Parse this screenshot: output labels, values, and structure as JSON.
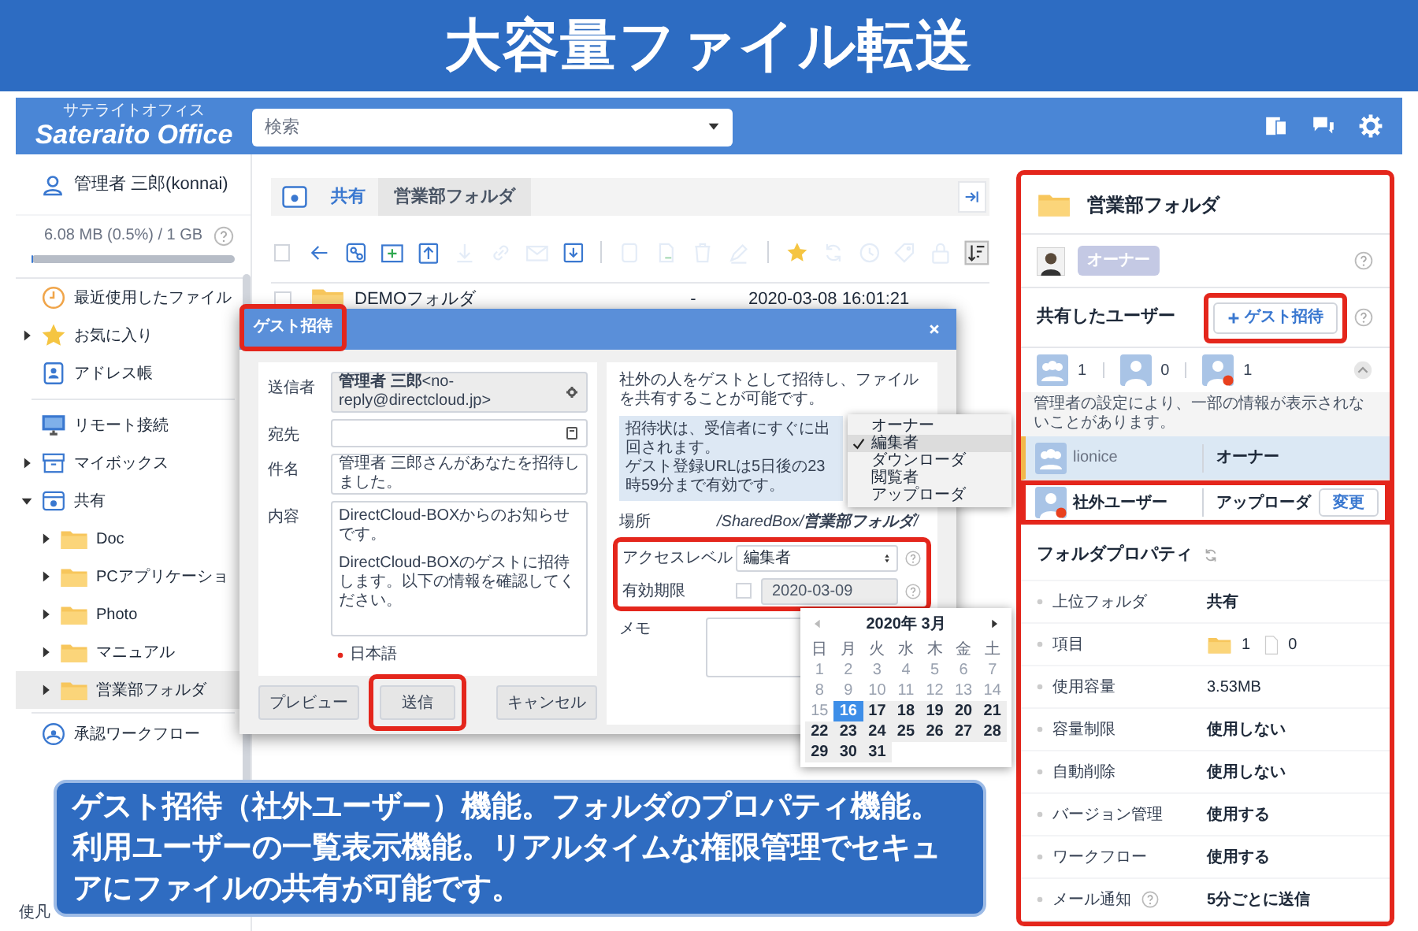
{
  "banner": {
    "title": "大容量ファイル転送"
  },
  "header": {
    "logo": "Sateraito Office",
    "logo_ruby": "サテライトオフィス",
    "search": {
      "placeholder": "検索"
    }
  },
  "sidebar": {
    "user": "管理者 三郎(konnai)",
    "storage": {
      "reading": "6.08 MB (0.5%) / 1 GB",
      "level": 0.005
    },
    "items": [
      {
        "label": "最近使用したファイル",
        "kind": "recent",
        "selected": false
      },
      {
        "label": "お気に入り",
        "kind": "favorite",
        "selected": false,
        "expanded": false
      },
      {
        "label": "アドレス帳",
        "kind": "contacts",
        "selected": false
      },
      {
        "label": "リモート接続",
        "kind": "remote",
        "selected": false
      },
      {
        "label": "マイボックス",
        "kind": "mybox",
        "selected": false,
        "expanded": false
      },
      {
        "label": "共有",
        "kind": "shared",
        "selected": false,
        "expanded": true,
        "children": [
          {
            "label": "Doc",
            "kind": "folder",
            "selected": false,
            "expanded": false
          },
          {
            "label": "PCアプリケーショ",
            "kind": "folder",
            "selected": false,
            "expanded": false
          },
          {
            "label": "Photo",
            "kind": "folder",
            "selected": false,
            "expanded": false
          },
          {
            "label": "マニュアル",
            "kind": "folder",
            "selected": false,
            "expanded": false
          },
          {
            "label": "営業部フォルダ",
            "kind": "folder",
            "selected": true,
            "expanded": false
          }
        ]
      },
      {
        "label": "承認ワークフロー",
        "kind": "workflow",
        "selected": false
      }
    ],
    "footer_text": "使凡"
  },
  "breadcrumb": [
    "共有",
    "営業部フォルダ"
  ],
  "toolbar": [
    {
      "kind": "back",
      "disabled": false
    },
    {
      "kind": "share",
      "disabled": false
    },
    {
      "kind": "newfolder",
      "disabled": false
    },
    {
      "kind": "upload",
      "disabled": false
    },
    {
      "kind": "download",
      "disabled": true
    },
    {
      "kind": "link",
      "disabled": true
    },
    {
      "kind": "mail",
      "disabled": true
    },
    {
      "kind": "inbox",
      "disabled": false
    },
    {
      "kind": "separator"
    },
    {
      "kind": "copy",
      "disabled": true
    },
    {
      "kind": "move",
      "disabled": true
    },
    {
      "kind": "trash",
      "disabled": true
    },
    {
      "kind": "pencil",
      "disabled": true
    },
    {
      "kind": "separator"
    },
    {
      "kind": "star",
      "disabled": false
    },
    {
      "kind": "sync",
      "disabled": true
    },
    {
      "kind": "clock",
      "disabled": true
    },
    {
      "kind": "tag",
      "disabled": true
    },
    {
      "kind": "lock",
      "disabled": true
    },
    {
      "kind": "sort",
      "disabled": false
    }
  ],
  "select_all": {
    "checked": false
  },
  "files": [
    {
      "name": "DEMOフォルダ",
      "size": "-",
      "modified": "2020-03-08 16:01:21",
      "checked": false
    }
  ],
  "dialog": {
    "title": "ゲスト招待",
    "title_highlighted": true,
    "fields": [
      {
        "label": "送信者",
        "value": "**管理者 三郎**<no-reply@directcloud.jp>",
        "kind": "sender"
      },
      {
        "label": "宛先",
        "kind": "recipient"
      },
      {
        "label": "件名",
        "value": "管理者 三郎さんがあなたを招待しました。",
        "kind": "text"
      },
      {
        "label": "内容",
        "kind": "textarea",
        "lines": [
          "DirectCloud-BOXからのお知らせです。",
          "DirectCloud-BOXのゲストに招待します。以下の情報を確認してください。"
        ]
      }
    ],
    "language": "日本語",
    "buttons": [
      {
        "label": "プレビュー",
        "highlighted": false
      },
      {
        "label": "送信",
        "highlighted": true
      },
      {
        "label": "キャンセル",
        "highlighted": false
      }
    ],
    "description": "社外の人をゲストとして招待し、ファイルを共有することが可能です。",
    "info": [
      "招待状は、受信者にすぐに出回されます。",
      "ゲスト登録URLは5日後の23時59分まで有効です。"
    ],
    "location_label": "場所",
    "location": "/SharedBox/**営業部フォルダ**/",
    "access_label": "アクセスレベル",
    "access_value": "編集者",
    "expiry_label": "有効期限",
    "expiry_checked": false,
    "expiry_value": "2020-03-09",
    "memo_label": "メモ",
    "settings_highlighted": true
  },
  "access_menu": [
    {
      "label": "オーナー",
      "selected": false
    },
    {
      "label": "編集者",
      "selected": true
    },
    {
      "label": "ダウンローダ",
      "selected": false
    },
    {
      "label": "閲覧者",
      "selected": false
    },
    {
      "label": "アップローダ",
      "selected": false
    }
  ],
  "calendar": {
    "title": "2020年 3月",
    "weekdays": [
      "日",
      "月",
      "火",
      "水",
      "木",
      "金",
      "土"
    ],
    "days": [
      {
        "label": "1",
        "disabled": true,
        "selected": false
      },
      {
        "label": "2",
        "disabled": true,
        "selected": false
      },
      {
        "label": "3",
        "disabled": true,
        "selected": false
      },
      {
        "label": "4",
        "disabled": true,
        "selected": false
      },
      {
        "label": "5",
        "disabled": true,
        "selected": false
      },
      {
        "label": "6",
        "disabled": true,
        "selected": false
      },
      {
        "label": "7",
        "disabled": true,
        "selected": false
      },
      {
        "label": "8",
        "disabled": true,
        "selected": false
      },
      {
        "label": "9",
        "disabled": true,
        "selected": false
      },
      {
        "label": "10",
        "disabled": true,
        "selected": false
      },
      {
        "label": "11",
        "disabled": true,
        "selected": false
      },
      {
        "label": "12",
        "disabled": true,
        "selected": false
      },
      {
        "label": "13",
        "disabled": true,
        "selected": false
      },
      {
        "label": "14",
        "disabled": true,
        "selected": false
      },
      {
        "label": "15",
        "disabled": true,
        "selected": false
      },
      {
        "label": "16",
        "disabled": false,
        "selected": true
      },
      {
        "label": "17",
        "disabled": false,
        "selected": false
      },
      {
        "label": "18",
        "disabled": false,
        "selected": false
      },
      {
        "label": "19",
        "disabled": false,
        "selected": false
      },
      {
        "label": "20",
        "disabled": false,
        "selected": false
      },
      {
        "label": "21",
        "disabled": false,
        "selected": false
      },
      {
        "label": "22",
        "disabled": false,
        "selected": false
      },
      {
        "label": "23",
        "disabled": false,
        "selected": false
      },
      {
        "label": "24",
        "disabled": false,
        "selected": false
      },
      {
        "label": "25",
        "disabled": false,
        "selected": false
      },
      {
        "label": "26",
        "disabled": false,
        "selected": false
      },
      {
        "label": "27",
        "disabled": false,
        "selected": false
      },
      {
        "label": "28",
        "disabled": false,
        "selected": false
      },
      {
        "label": "29",
        "disabled": false,
        "selected": false
      },
      {
        "label": "30",
        "disabled": false,
        "selected": false
      },
      {
        "label": "31",
        "disabled": false,
        "selected": false
      }
    ]
  },
  "details": {
    "highlighted": true,
    "folder_name": "営業部フォルダ",
    "owner_badge": "オーナー",
    "shared_heading": "共有したユーザー",
    "invite_button": {
      "label": "ゲスト招待",
      "highlighted": true
    },
    "counts": [
      {
        "kind": "group",
        "count": "1"
      },
      {
        "kind": "user",
        "count": "0"
      },
      {
        "kind": "guest",
        "count": "1"
      }
    ],
    "members_expanded": true,
    "notice": "管理者の設定により、一部の情報が表示されないことがあります。",
    "members": [
      {
        "kind": "group",
        "name": "lionice",
        "role": "オーナー",
        "highlighted": false
      },
      {
        "kind": "guest",
        "name": "社外ユーザー",
        "role": "アップローダ",
        "action": "変更",
        "highlighted": true
      }
    ],
    "properties_heading": "フォルダプロパティ",
    "properties": [
      {
        "label": "上位フォルダ",
        "kind": "strong",
        "value": "共有",
        "help": false
      },
      {
        "label": "項目",
        "kind": "counts",
        "folders": "1",
        "files": "0",
        "help": false
      },
      {
        "label": "使用容量",
        "kind": "plain",
        "value": "3.53MB",
        "help": false
      },
      {
        "label": "容量制限",
        "kind": "strong",
        "value": "使用しない",
        "help": false
      },
      {
        "label": "自動削除",
        "kind": "strong",
        "value": "使用しない",
        "help": false
      },
      {
        "label": "バージョン管理",
        "kind": "strong",
        "value": "使用する",
        "help": false
      },
      {
        "label": "ワークフロー",
        "kind": "strong",
        "value": "使用する",
        "help": false
      },
      {
        "label": "メール通知",
        "kind": "strong",
        "value": "5分ごとに送信",
        "help": true
      }
    ]
  },
  "caption": "ゲスト招待（社外ユーザー）機能。フォルダのプロパティ機能。利用ユーザーの一覧表示機能。リアルタイムな権限管理でセキュアにファイルの共有が可能です。"
}
